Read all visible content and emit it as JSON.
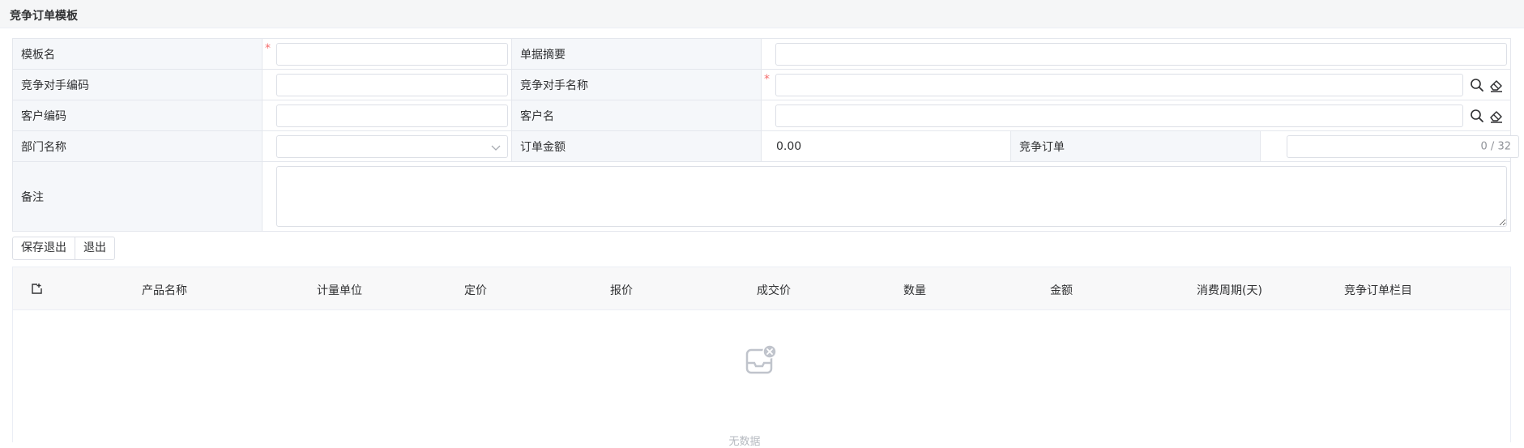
{
  "page": {
    "title": "竞争订单模板"
  },
  "form": {
    "template_name": {
      "label": "模板名",
      "value": ""
    },
    "summary": {
      "label": "单据摘要",
      "value": ""
    },
    "competitor_code": {
      "label": "竞争对手编码",
      "value": ""
    },
    "competitor_name": {
      "label": "竞争对手名称",
      "value": ""
    },
    "customer_code": {
      "label": "客户编码",
      "value": ""
    },
    "customer_name": {
      "label": "客户名",
      "value": ""
    },
    "department": {
      "label": "部门名称",
      "value": ""
    },
    "order_amount": {
      "label": "订单金额",
      "value": "0.00"
    },
    "competitive_order": {
      "label": "竞争订单",
      "counter": "0 / 32"
    },
    "remark": {
      "label": "备注",
      "value": ""
    },
    "required_mark": "*"
  },
  "actions": {
    "save_exit": "保存退出",
    "exit": "退出"
  },
  "grid": {
    "columns": [
      "产品名称",
      "计量单位",
      "定价",
      "报价",
      "成交价",
      "数量",
      "金额",
      "消费周期(天)",
      "竞争订单栏目"
    ],
    "empty_text": "无数据"
  },
  "colors": {
    "required": "#f56c6c",
    "header_bg": "#f5f6f7",
    "label_bg": "#f5f7fa",
    "border": "#e4e7ed"
  },
  "icons": [
    "export-icon",
    "search-icon",
    "eraser-icon",
    "chevron-down-icon",
    "empty-inbox-icon"
  ]
}
